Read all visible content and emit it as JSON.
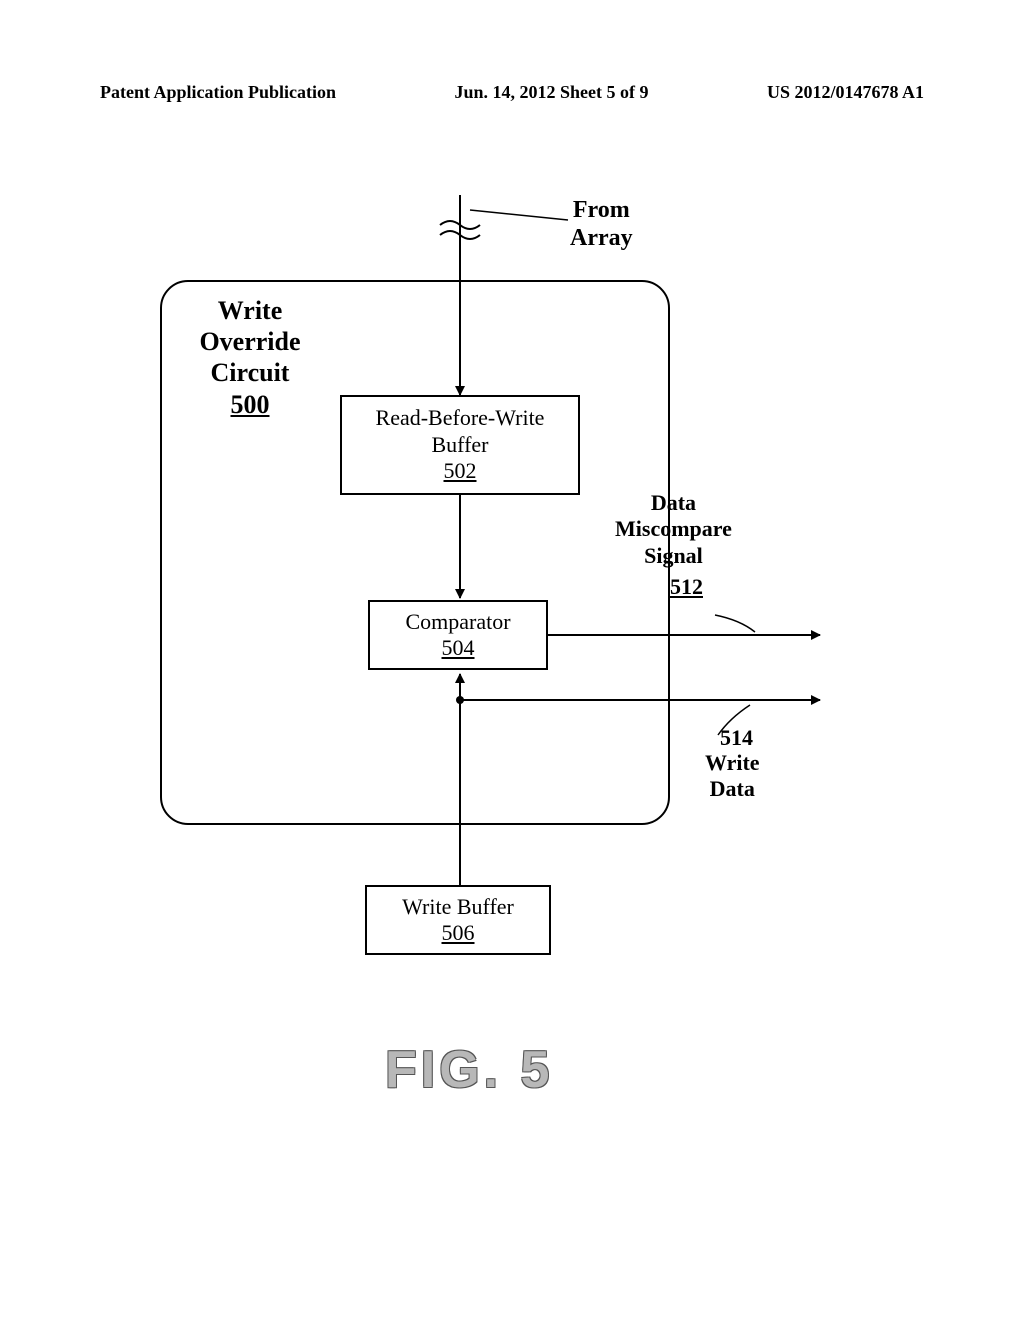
{
  "header": {
    "left": "Patent Application Publication",
    "center": "Jun. 14, 2012  Sheet 5 of 9",
    "right": "US 2012/0147678 A1"
  },
  "external_labels": {
    "from_array_l1": "From",
    "from_array_l2": "Array",
    "miscompare_l1": "Data",
    "miscompare_l2": "Miscompare",
    "miscompare_l3": "Signal",
    "miscompare_ref": "512",
    "write_data_l1": "Write",
    "write_data_l2": "Data",
    "write_data_ref": "514"
  },
  "blocks": {
    "title500_l1": "Write",
    "title500_l2": "Override",
    "title500_l3": "Circuit",
    "title500_ref": "500",
    "b502_l1": "Read-Before-Write",
    "b502_l2": "Buffer",
    "b502_ref": "502",
    "b504_l1": "Comparator",
    "b504_ref": "504",
    "b506_l1": "Write Buffer",
    "b506_ref": "506"
  },
  "figure": "FIG.  5"
}
